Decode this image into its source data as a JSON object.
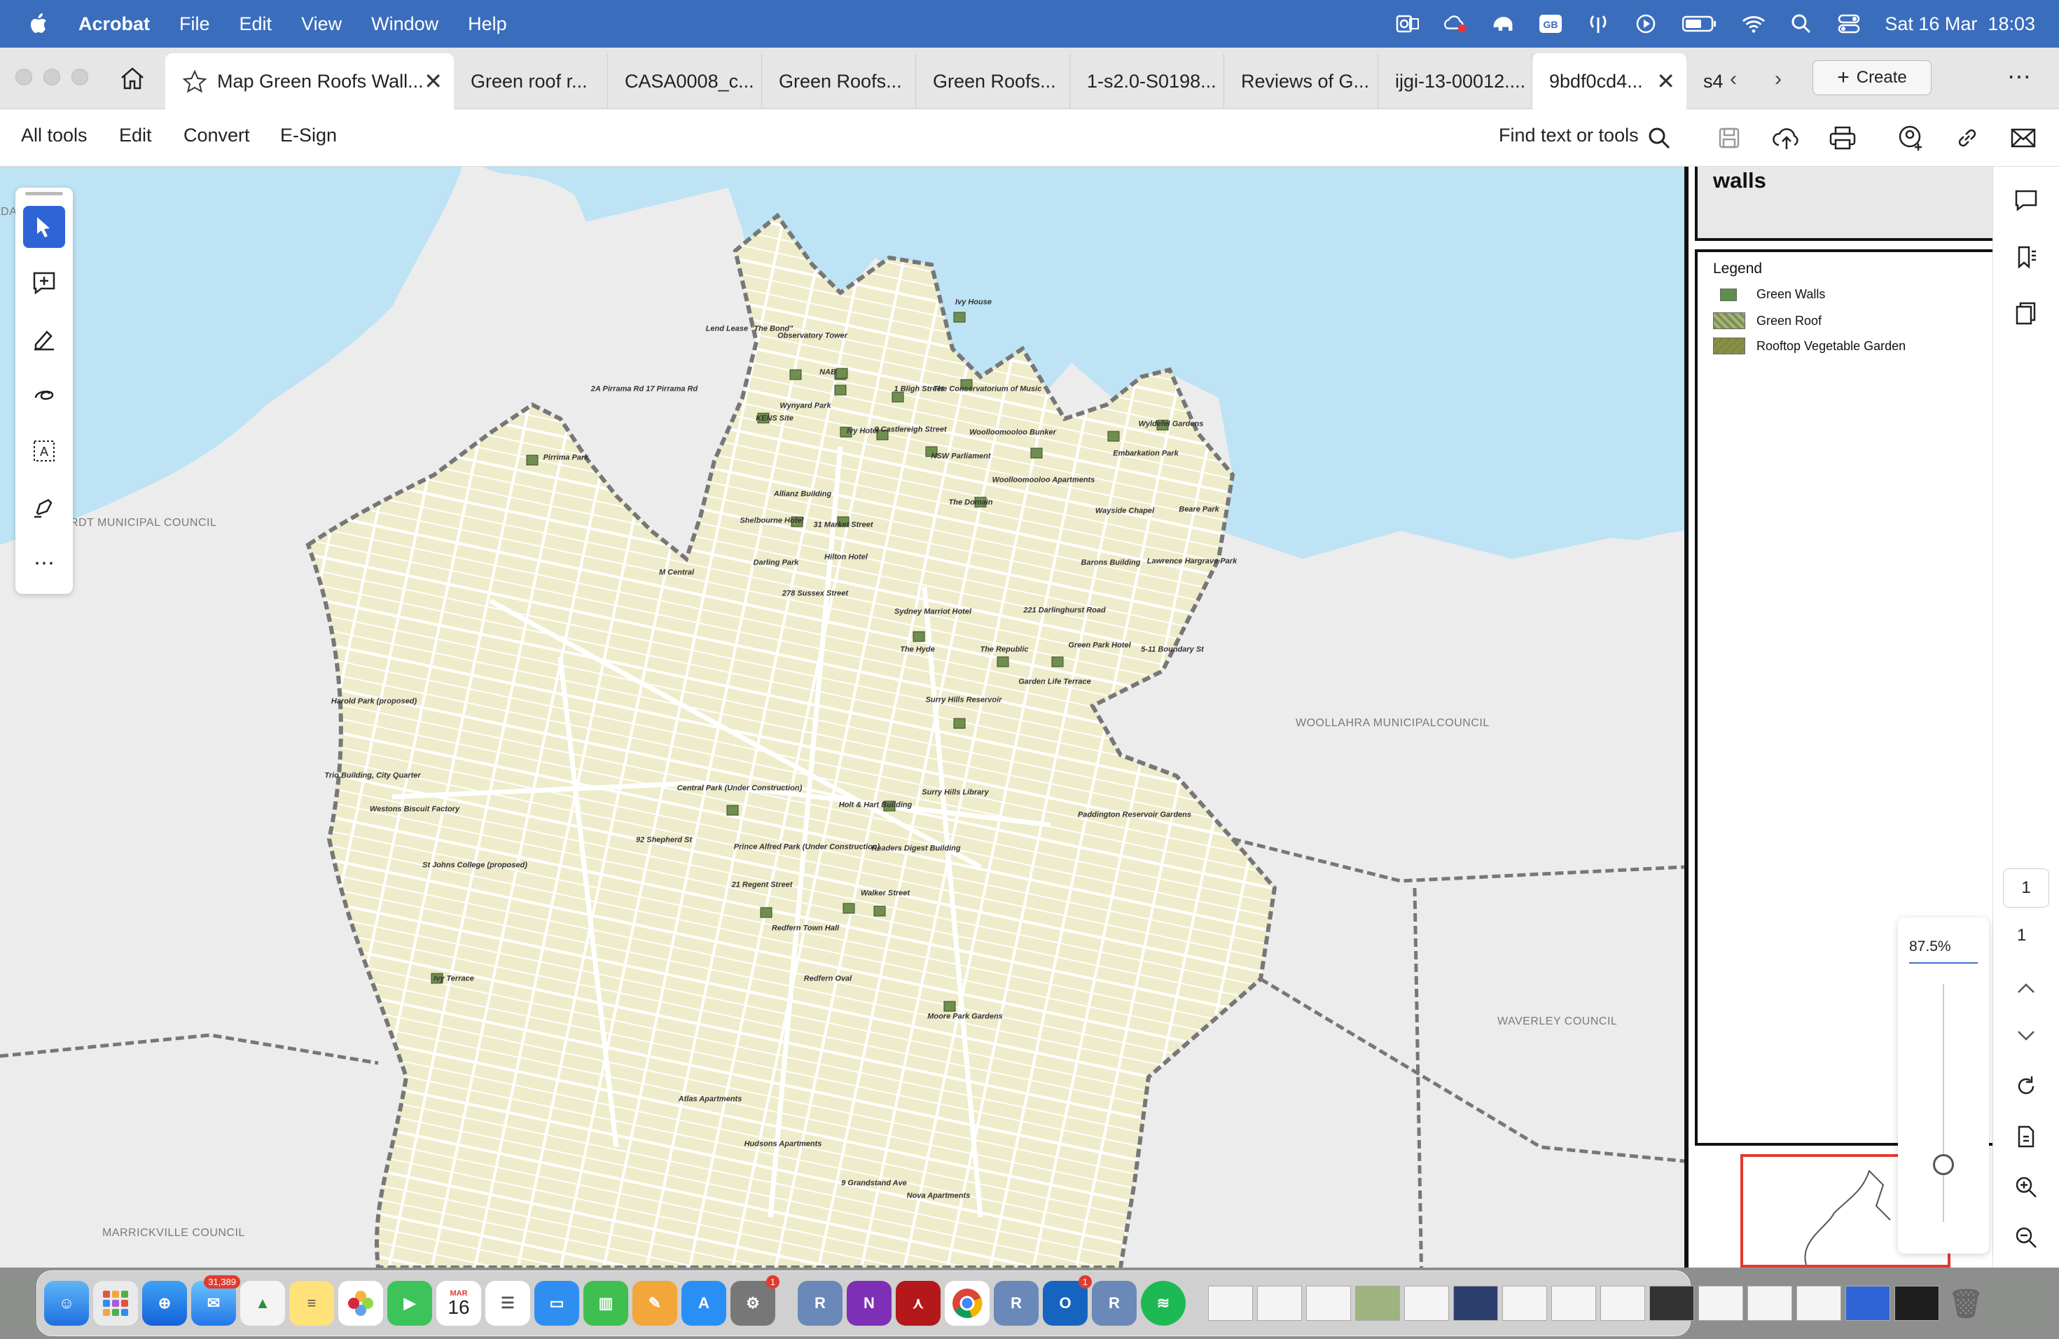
{
  "menubar": {
    "app_name": "Acrobat",
    "items": [
      "File",
      "Edit",
      "View",
      "Window",
      "Help"
    ],
    "datetime": "Sat 16 Mar  18:03",
    "input_source": "GB"
  },
  "tabs": [
    {
      "label": "Map Green Roofs Wall...",
      "active": true,
      "starred": true
    },
    {
      "label": "Green roof r..."
    },
    {
      "label": "CASA0008_c..."
    },
    {
      "label": "Green Roofs..."
    },
    {
      "label": "Green Roofs..."
    },
    {
      "label": "1-s2.0-S0198..."
    },
    {
      "label": "Reviews of G..."
    },
    {
      "label": "ijgi-13-00012...."
    },
    {
      "label": "9bdf0cd4...",
      "closable": true
    },
    {
      "label": "s4"
    }
  ],
  "create_label": "Create",
  "toolbar": {
    "all_tools": "All tools",
    "edit": "Edit",
    "convert": "Convert",
    "esign": "E-Sign",
    "find": "Find text or tools"
  },
  "map": {
    "title_fragment": "walls",
    "legend_title": "Legend",
    "legend": [
      {
        "label": "Green Walls",
        "color": "#5e8f4c"
      },
      {
        "label": "Green Roof",
        "color": "#7c8f56"
      },
      {
        "label": "Rooftop Vegetable Garden",
        "color": "#9b8a3c"
      }
    ],
    "councils": [
      "ADA",
      "RDT MUNICIPAL COUNCIL",
      "WOOLLAHRA MUNICIPALCOUNCIL",
      "WAVERLEY COUNCIL",
      "MARRICKVILLE COUNCIL"
    ],
    "sites": [
      "Lend Lease \"The Bond\"",
      "Observatory Tower",
      "Ivy House",
      "NAB",
      "1 Bligh Street",
      "The Conservatorium of Music",
      "2A Pirrama Rd 17 Pirrama Rd",
      "KENS Site",
      "Wynyard Park",
      "Ivy Hotel",
      "9 Castlereigh Street",
      "Woolloomooloo Bunker",
      "Wyldefel Gardens",
      "Pirrima Park",
      "NSW Parliament",
      "Embarkation Park",
      "Woolloomooloo Apartments",
      "Allianz Building",
      "The Domain",
      "Wayside Chapel",
      "Beare Park",
      "Shelbourne Hotel",
      "31 Market Street",
      "Hilton Hotel",
      "Darling Park",
      "M Central",
      "278 Sussex Street",
      "Barons Building",
      "Lawrence Hargrave Park",
      "Sydney Marriot Hotel",
      "221 Darlinghurst Road",
      "The Hyde",
      "The Republic",
      "Green Park Hotel",
      "5-11 Boundary St",
      "Garden Life Terrace",
      "Harold Park (proposed)",
      "Surry Hills Reservoir",
      "Trio Building, City Quarter",
      "Westons Biscuit Factory",
      "Central Park (Under Construction)",
      "Holt & Hart Building",
      "Surry Hills Library",
      "Paddington Reservoir Gardens",
      "92 Shepherd St",
      "Prince Alfred Park (Under Construction)",
      "Readers Digest Building",
      "St Johns College (proposed)",
      "21 Regent Street",
      "Walker Street",
      "Redfern Town Hall",
      "Redfern Oval",
      "Ivy Terrace",
      "Moore Park Gardens",
      "Atlas Apartments",
      "Hudsons Apartments",
      "9 Grandstand Ave",
      "Nova Apartments"
    ]
  },
  "viewer": {
    "page_current": "1",
    "page_total": "1",
    "zoom": "87.5%"
  },
  "dock": {
    "mail_badge": "31,389",
    "calendar_month": "MAR",
    "calendar_day": "16",
    "settings_badge": "1",
    "outlook_badge": "1"
  }
}
